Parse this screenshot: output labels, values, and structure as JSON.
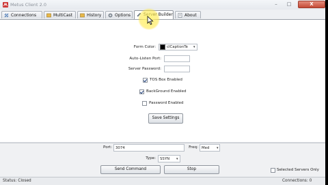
{
  "window": {
    "title": "Metus Client 2.0",
    "controls": {
      "minimize": "–",
      "maximize": "□",
      "close": "X"
    }
  },
  "tabs": [
    {
      "label": "Connections",
      "icon": "connections-icon",
      "active": false
    },
    {
      "label": "MultiCast",
      "icon": "multicast-icon",
      "active": false
    },
    {
      "label": "History",
      "icon": "history-icon",
      "active": false
    },
    {
      "label": "Options",
      "icon": "options-icon",
      "active": false
    },
    {
      "label": "Server Builder",
      "icon": "pencil-icon",
      "active": true
    },
    {
      "label": "About",
      "icon": "about-icon",
      "active": false
    }
  ],
  "server_builder": {
    "form_color_label": "Form Color:",
    "form_color_value": "clCaptionTe",
    "form_color_swatch": "#000000",
    "auto_listen_port_label": "Auto-Listen Port:",
    "auto_listen_port_value": "",
    "server_password_label": "Server Password:",
    "server_password_value": "",
    "tos_box_label": "TOS Box Enabled",
    "tos_box_checked": true,
    "background_label": "BackGround Enabled",
    "background_checked": true,
    "password_enabled_label": "Password Enabled",
    "password_enabled_checked": false,
    "save_button": "Save Settings"
  },
  "command_panel": {
    "port_label": "Port:",
    "port_value": "3074",
    "freq_label": "Freq:",
    "freq_value": "Med",
    "type_label": "Type:",
    "type_value": "SSYN",
    "send_button": "Send Command",
    "stop_button": "Stop",
    "selected_servers_label": "Selected Servers Only",
    "selected_servers_checked": false
  },
  "status": {
    "left": "Status: Closed",
    "right": "Connections: 0"
  }
}
